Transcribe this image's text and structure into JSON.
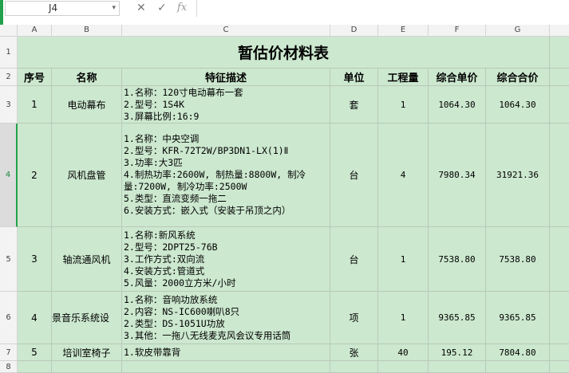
{
  "formula_bar": {
    "cell_ref": "J4",
    "cancel_icon": "✕",
    "confirm_icon": "✓",
    "fx_label": "fx",
    "formula": ""
  },
  "columns": [
    "A",
    "B",
    "C",
    "D",
    "E",
    "F",
    "G"
  ],
  "row_numbers": [
    "1",
    "2",
    "3",
    "4",
    "5",
    "6",
    "7",
    "8"
  ],
  "sheet": {
    "title": "暂估价材料表",
    "headers": [
      "序号",
      "名称",
      "特征描述",
      "单位",
      "工程量",
      "综合单价",
      "综合合价"
    ],
    "rows": [
      {
        "no": "1",
        "name": "电动幕布",
        "desc": [
          "1.名称：120寸电动幕布一套",
          "2.型号：1S4K",
          "3.屏幕比例:16:9"
        ],
        "unit": "套",
        "qty": "1",
        "price": "1064.30",
        "total": "1064.30"
      },
      {
        "no": "2",
        "name": "风机盘管",
        "desc": [
          "1.名称：中央空调",
          "2.型号：KFR-72T2W/BP3DN1-LX(1)Ⅱ",
          "3.功率:大3匹",
          "4.制热功率:2600W, 制热量:8800W, 制冷",
          "量:7200W, 制冷功率:2500W",
          "5.类型：直流变频一拖二",
          "6.安装方式：嵌入式（安装于吊顶之内）"
        ],
        "unit": "台",
        "qty": "4",
        "price": "7980.34",
        "total": "31921.36"
      },
      {
        "no": "3",
        "name": "轴流通风机",
        "desc": [
          "1.名称:新风系统",
          "2.型号：2DPT25-76B",
          "3.工作方式:双向流",
          "4.安装方式:管道式",
          "5.风量：2000立方米/小时"
        ],
        "unit": "台",
        "qty": "1",
        "price": "7538.80",
        "total": "7538.80"
      },
      {
        "no": "4",
        "name": "景音乐系统设",
        "desc": [
          "1.名称：音响功放系统",
          "2.内容：NS-IC600喇叭8只",
          "2.类型：DS-1051U功放",
          "3.其他：一拖八无线麦克风会议专用话筒"
        ],
        "unit": "项",
        "qty": "1",
        "price": "9365.85",
        "total": "9365.85"
      },
      {
        "no": "5",
        "name": "培训室椅子",
        "desc": [
          "1.软皮带靠背"
        ],
        "unit": "张",
        "qty": "40",
        "price": "195.12",
        "total": "7804.80"
      }
    ]
  }
}
